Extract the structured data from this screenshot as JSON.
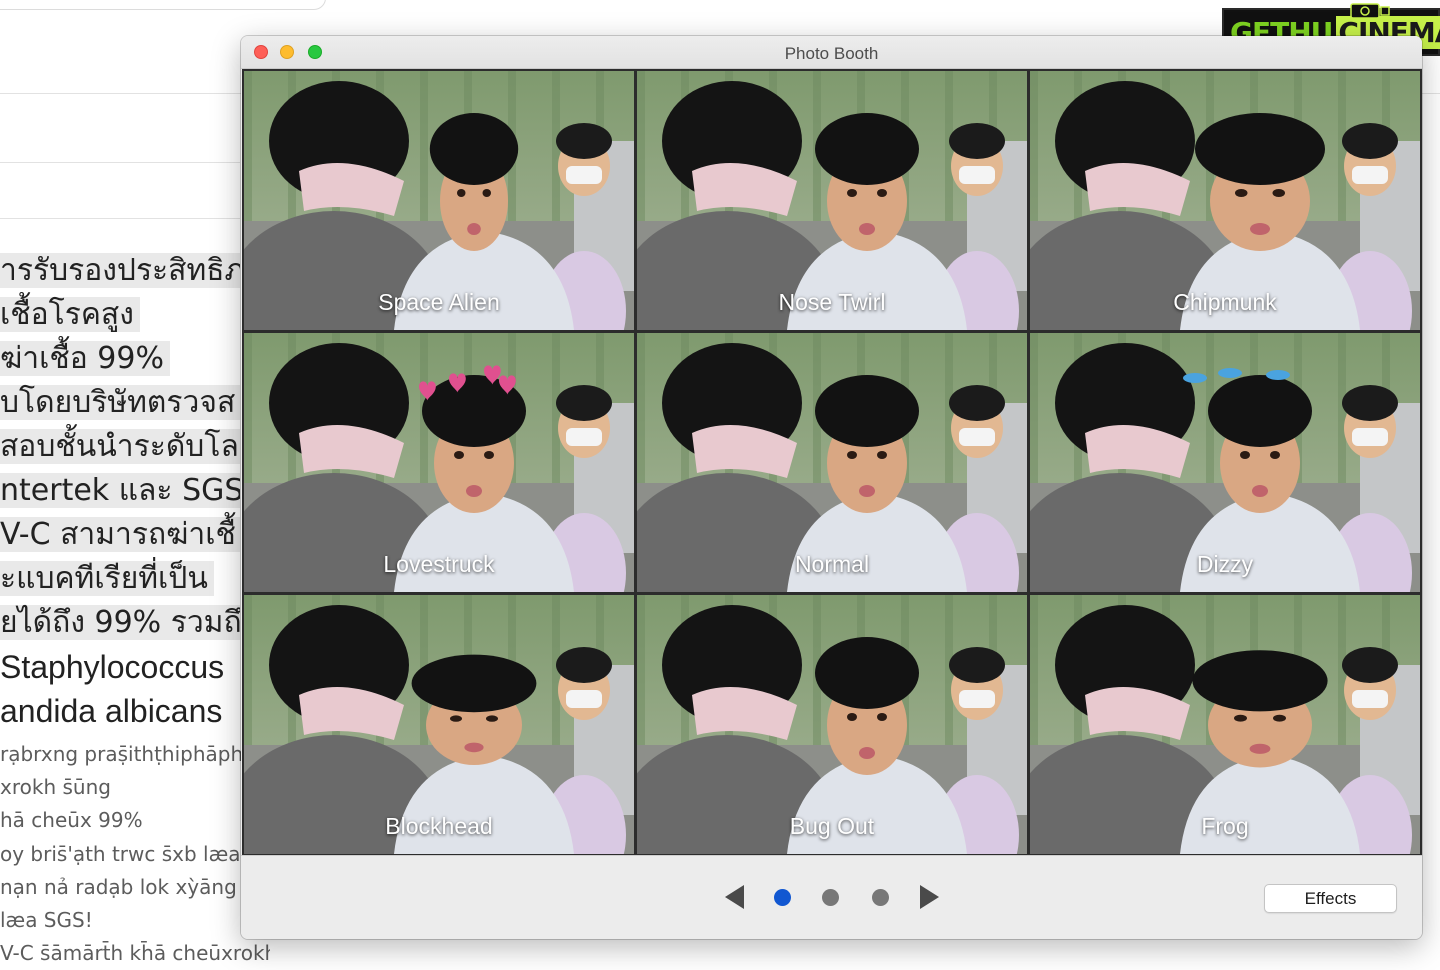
{
  "background_page": {
    "thai_lines": [
      "ารรับรองประสิทธิภ",
      "เชื้อโรคสูง",
      "ฆ่าเชื้อ 99%",
      "บโดยบริษัทตรวจส",
      "สอบชั้นนำระดับโล",
      "ntertek และ SGS",
      "V-C สามารถฆ่าเชื้",
      "ะแบคทีเรียที่เป็น",
      "ยได้ถึง 99% รวมถึ",
      " Staphylococcus",
      "andida albicans"
    ],
    "transliteration_lines": [
      "rạbrxng praṣ̄ithṭhiphāph",
      "xrokh s̄ūng",
      "hā cheūx 99%",
      "oy bris̄'ạth trwc s̄xb læa",
      "nạn nả radạb lok xỳāng",
      "læa SGS!",
      "V-C s̄āmārt̄h kh̄ā cheūxrokh"
    ]
  },
  "watermark": {
    "part1": "GETHU",
    "part2": "CINEMA"
  },
  "window": {
    "title": "Photo Booth",
    "effects": [
      {
        "label": "Space Alien"
      },
      {
        "label": "Nose Twirl"
      },
      {
        "label": "Chipmunk"
      },
      {
        "label": "Lovestruck"
      },
      {
        "label": "Normal"
      },
      {
        "label": "Dizzy"
      },
      {
        "label": "Blockhead"
      },
      {
        "label": "Bug Out"
      },
      {
        "label": "Frog"
      }
    ],
    "pagination": {
      "current_page": 1,
      "total_pages": 3,
      "active_color": "#1157d1"
    },
    "effects_button_label": "Effects"
  }
}
